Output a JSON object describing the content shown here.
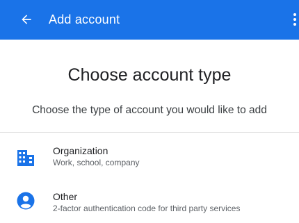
{
  "appbar": {
    "title": "Add account",
    "back_icon": "arrow-back-icon",
    "overflow_icon": "more-vert-icon",
    "color": "#1a73e8"
  },
  "main": {
    "heading": "Choose account type",
    "subheading": "Choose the type of account you would like to add"
  },
  "options": [
    {
      "icon": "organization-icon",
      "title": "Organization",
      "description": "Work, school, company",
      "icon_color": "#1a73e8"
    },
    {
      "icon": "person-icon",
      "title": "Other",
      "description": "2-factor authentication code for third party services",
      "icon_color": "#1a73e8"
    }
  ]
}
